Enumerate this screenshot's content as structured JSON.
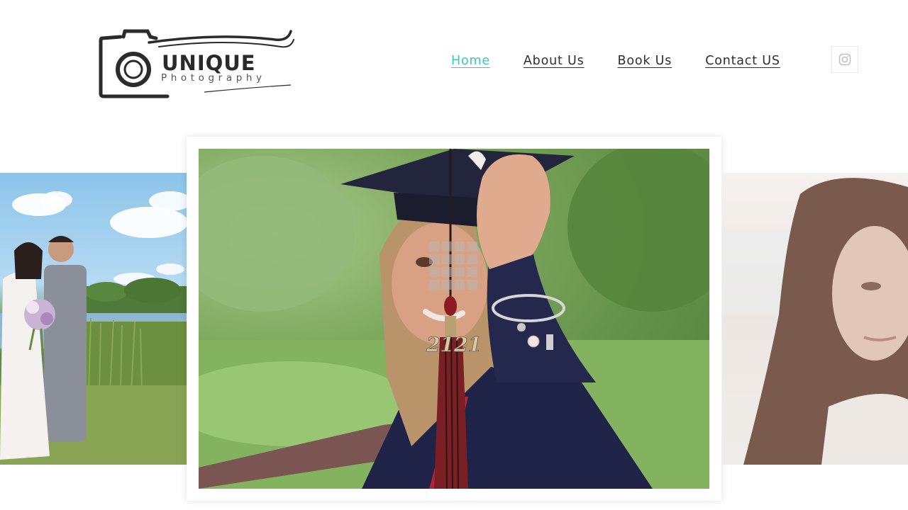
{
  "brand": {
    "name": "UNIQUE",
    "tagline": "Photography"
  },
  "nav": {
    "items": [
      {
        "label": "Home",
        "active": true
      },
      {
        "label": "About Us",
        "active": false
      },
      {
        "label": "Book Us",
        "active": false
      },
      {
        "label": "Contact US",
        "active": false
      }
    ],
    "active_color": "#3fc7b4"
  },
  "social": {
    "icon": "instagram-icon"
  },
  "slider": {
    "slides": [
      {
        "subject": "wedding-couple-photo"
      },
      {
        "subject": "graduate-with-tassel-photo",
        "tassel_charm": "2121"
      },
      {
        "subject": "woman-portrait-photo"
      }
    ],
    "loading_icon": "loading-grid-icon"
  }
}
